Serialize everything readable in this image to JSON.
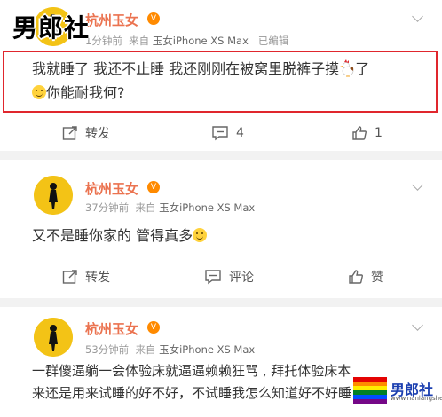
{
  "watermark_top": "男郎社",
  "posts": [
    {
      "username": "杭州玉女",
      "time": "1分钟前",
      "source_prefix": "来自",
      "source": "玉女iPhone XS Max",
      "edited": "已编辑",
      "line1_a": "我就睡了 我还不止睡 我还刚刚在被窝里脱裤子摸",
      "line1_b": "了",
      "line2": "你能耐我何?",
      "repost_label": "转发",
      "comment_count": "4",
      "like_count": "1"
    },
    {
      "username": "杭州玉女",
      "time": "37分钟前",
      "source_prefix": "来自",
      "source": "玉女iPhone XS Max",
      "content": "又不是睡你家的 管得真多",
      "repost_label": "转发",
      "comment_label": "评论",
      "like_label": "赞"
    },
    {
      "username": "杭州玉女",
      "time": "53分钟前",
      "source_prefix": "来自",
      "source": "玉女iPhone XS Max",
      "line1": "一群傻逼躺一会体验床就逼逼赖赖狂骂 , 拜托体验床本",
      "line2": "来还是用来试睡的好不好，不试睡我怎么知道好不好睡"
    }
  ],
  "logo_br": {
    "text": "男郎社",
    "sub": "www.nanlangshe.com"
  },
  "colors": {
    "username": "#eb7350",
    "highlight": "#e0262d",
    "avatar_bg": "#f3c316"
  },
  "icons": [
    "chevron-down-icon",
    "repost-icon",
    "comment-icon",
    "like-icon",
    "vip-badge-icon",
    "smile-emoji-icon",
    "rooster-emoji-icon"
  ]
}
